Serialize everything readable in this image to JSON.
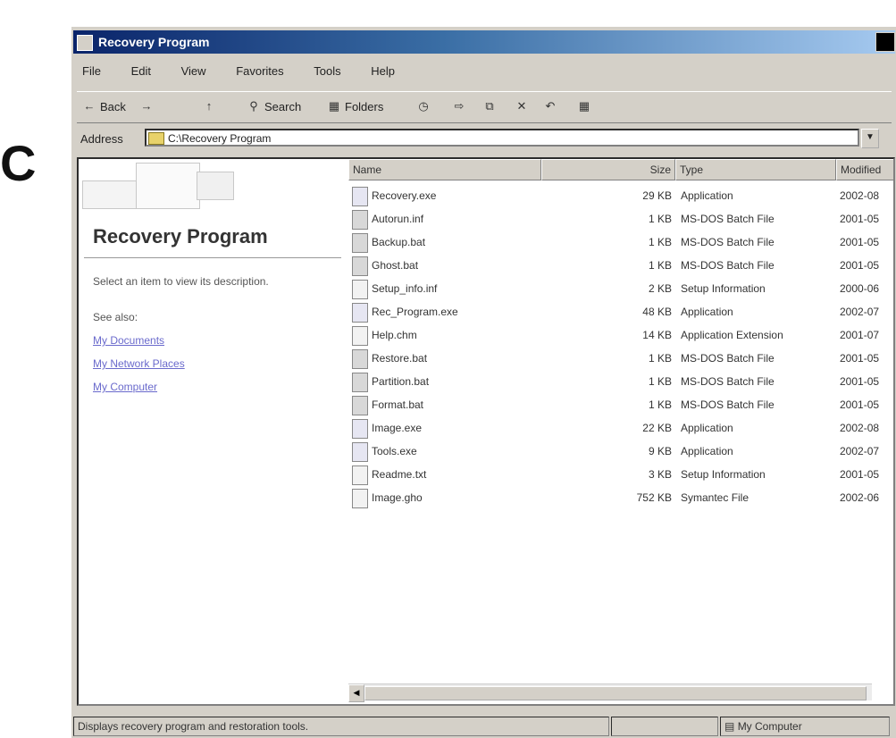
{
  "panel_letter": "C",
  "window": {
    "title": "Recovery Program",
    "menu": [
      "File",
      "Edit",
      "View",
      "Favorites",
      "Tools",
      "Help"
    ],
    "toolbar": [
      {
        "label": "Back",
        "icon": "back-arrow-icon"
      },
      {
        "label": "",
        "icon": "forward-arrow-icon"
      },
      {
        "label": "",
        "icon": "up-folder-icon"
      },
      {
        "label": "Search",
        "icon": "search-icon"
      },
      {
        "label": "Folders",
        "icon": "folders-icon"
      },
      {
        "label": "",
        "icon": "history-icon"
      },
      {
        "label": "",
        "icon": "move-to-icon"
      },
      {
        "label": "",
        "icon": "copy-to-icon"
      },
      {
        "label": "",
        "icon": "delete-icon"
      },
      {
        "label": "",
        "icon": "undo-icon"
      },
      {
        "label": "",
        "icon": "views-icon"
      }
    ],
    "address": {
      "label": "Address",
      "value": "C:\\Recovery Program"
    }
  },
  "left_pane": {
    "title": "Recovery Program",
    "description": "Select an item to view its description.",
    "see_also": "See also:",
    "links": [
      "My Documents",
      "My Network Places",
      "My Computer"
    ]
  },
  "list": {
    "columns": [
      "Name",
      "Size",
      "Type",
      "Modified"
    ],
    "rows": [
      {
        "name": "Recovery.exe",
        "size": "29 KB",
        "type": "Application",
        "modified": "2002-08",
        "icon": "application-icon"
      },
      {
        "name": "Autorun.inf",
        "size": "1 KB",
        "type": "MS-DOS Batch File",
        "modified": "2001-05",
        "icon": "batch-file-icon"
      },
      {
        "name": "Backup.bat",
        "size": "1 KB",
        "type": "MS-DOS Batch File",
        "modified": "2001-05",
        "icon": "batch-file-icon"
      },
      {
        "name": "Ghost.bat",
        "size": "1 KB",
        "type": "MS-DOS Batch File",
        "modified": "2001-05",
        "icon": "batch-file-icon"
      },
      {
        "name": "Setup_info.inf",
        "size": "2 KB",
        "type": "Setup Information",
        "modified": "2000-06",
        "icon": "setup-info-icon"
      },
      {
        "name": "Rec_Program.exe",
        "size": "48 KB",
        "type": "Application",
        "modified": "2002-07",
        "icon": "application-icon"
      },
      {
        "name": "Help.chm",
        "size": "14 KB",
        "type": "Application Extension",
        "modified": "2001-07",
        "icon": "document-icon"
      },
      {
        "name": "Restore.bat",
        "size": "1 KB",
        "type": "MS-DOS Batch File",
        "modified": "2001-05",
        "icon": "batch-file-icon"
      },
      {
        "name": "Partition.bat",
        "size": "1 KB",
        "type": "MS-DOS Batch File",
        "modified": "2001-05",
        "icon": "batch-file-icon"
      },
      {
        "name": "Format.bat",
        "size": "1 KB",
        "type": "MS-DOS Batch File",
        "modified": "2001-05",
        "icon": "batch-file-icon"
      },
      {
        "name": "Image.exe",
        "size": "22 KB",
        "type": "Application",
        "modified": "2002-08",
        "icon": "application-icon"
      },
      {
        "name": "Tools.exe",
        "size": "9 KB",
        "type": "Application",
        "modified": "2002-07",
        "icon": "application-icon"
      },
      {
        "name": "Readme.txt",
        "size": "3 KB",
        "type": "Setup Information",
        "modified": "2001-05",
        "icon": "text-file-icon"
      },
      {
        "name": "Image.gho",
        "size": "752 KB",
        "type": "Symantec File",
        "modified": "2002-06",
        "icon": "document-icon"
      }
    ]
  },
  "status": {
    "left": "Displays recovery program and restoration tools.",
    "middle": "",
    "right": "My Computer"
  }
}
